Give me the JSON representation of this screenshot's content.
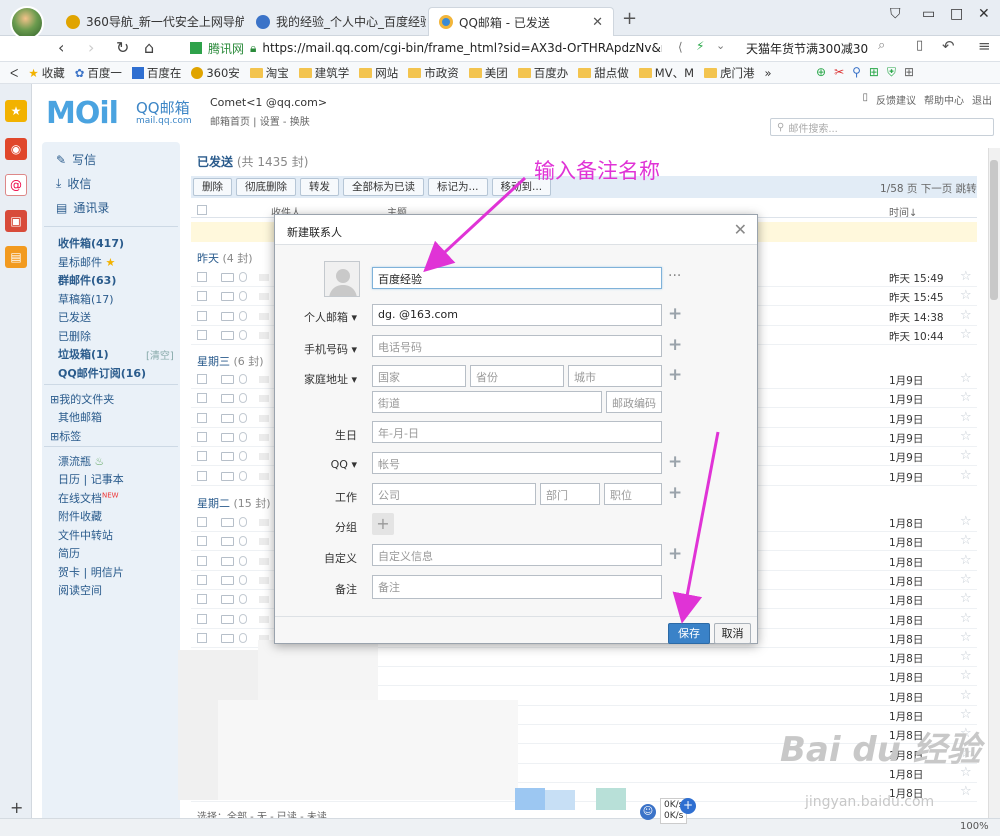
{
  "browser": {
    "tabs": [
      {
        "title": "360导航_新一代安全上网导航",
        "color": "#e0a400"
      },
      {
        "title": "我的经验_个人中心_百度经验",
        "color": "#3b73c8"
      },
      {
        "title": "QQ邮箱 - 已发送",
        "color": "#3a8bd6"
      }
    ],
    "new_tab": "+",
    "url_site": "腾讯网",
    "url": "https://mail.qq.com/cgi-bin/frame_html?sid=AX3d-OrTHRApdzNv&r=98c2",
    "search_hint": "天猫年货节满300减30"
  },
  "bookmarks": [
    "收藏",
    "百度一",
    "百度在",
    "360安",
    "淘宝",
    "建筑学",
    "网站",
    "市政资",
    "美团",
    "百度办",
    "甜点做",
    "MV、M",
    "虎门港"
  ],
  "mail": {
    "logo_main": "MOil",
    "logo_cn": "QQ邮箱",
    "logo_domain": "mail.qq.com",
    "account": "Comet<1        @qq.com>",
    "account_sub": "邮箱首页 | 设置 - 换肤",
    "top_links": [
      "反馈建议",
      "帮助中心",
      "退出"
    ],
    "search_placeholder": "邮件搜索...",
    "actions": {
      "write": "写信",
      "receive": "收信",
      "contacts": "通讯录"
    },
    "folders": [
      {
        "label": "收件箱(417)",
        "bold": true
      },
      {
        "label": "星标邮件",
        "bold": false
      },
      {
        "label": "群邮件(63)",
        "bold": true
      },
      {
        "label": "草稿箱(17)",
        "bold": false
      },
      {
        "label": "已发送",
        "bold": false
      },
      {
        "label": "已删除",
        "bold": false
      },
      {
        "label": "垃圾箱(1)",
        "bold": true
      },
      {
        "label": "QQ邮件订阅(16)",
        "bold": true
      }
    ],
    "clear_label": "[清空]",
    "folders2": [
      "我的文件夹",
      "其他邮箱",
      "标签"
    ],
    "tools": [
      "漂流瓶",
      "日历 | 记事本",
      "在线文档",
      "附件收藏",
      "文件中转站",
      "简历",
      "贺卡 | 明信片",
      "阅读空间"
    ],
    "list_title": "已发送",
    "list_count": "(共 1435 封)",
    "toolbar": [
      "删除",
      "彻底删除",
      "转发",
      "全部标为已读",
      "标记为...",
      "移动到..."
    ],
    "pager": "1/58 页  下一页  跳转",
    "columns": {
      "from": "收件人",
      "subject": "主题",
      "time": "时间↓"
    },
    "groups": [
      {
        "label": "昨天",
        "count": "(4 封)"
      },
      {
        "label": "星期三",
        "count": "(6 封)"
      },
      {
        "label": "星期二",
        "count": "(15 封)"
      }
    ],
    "times_yesterday": [
      "昨天 15:49",
      "昨天 15:45",
      "昨天 14:38",
      "昨天 10:44"
    ],
    "times_wed": [
      "1月9日",
      "1月9日",
      "1月9日",
      "1月9日",
      "1月9日",
      "1月9日"
    ],
    "times_tue": [
      "1月8日",
      "1月8日",
      "1月8日",
      "1月8日",
      "1月8日",
      "1月8日",
      "1月8日",
      "1月8日",
      "1月8日",
      "1月8日",
      "1月8日",
      "1月8日",
      "1月8日",
      "1月8日",
      "1月8日"
    ],
    "bottom_select": "选择：全部 - 无 - 已读 - 未读"
  },
  "dialog": {
    "title": "新建联系人",
    "name_value": "百度经验",
    "email_label": "个人邮箱",
    "email_value": "dg.        @163.com",
    "phone_label": "手机号码",
    "phone_placeholder": "电话号码",
    "address_label": "家庭地址",
    "country_placeholder": "国家",
    "province_placeholder": "省份",
    "city_placeholder": "城市",
    "street_placeholder": "街道",
    "zip_placeholder": "邮政编码",
    "birthday_label": "生日",
    "birthday_placeholder": "年-月-日",
    "qq_label": "QQ",
    "qq_placeholder": "帐号",
    "work_label": "工作",
    "company_placeholder": "公司",
    "dept_placeholder": "部门",
    "position_placeholder": "职位",
    "group_label": "分组",
    "custom_label": "自定义",
    "custom_placeholder": "自定义信息",
    "note_label": "备注",
    "note_placeholder": "备注",
    "save": "保存",
    "cancel": "取消",
    "more": "···",
    "plus": "+"
  },
  "annotation": {
    "text": "输入备注名称",
    "color": "#e033d6"
  },
  "watermark": {
    "main": "Bai du 经验",
    "sub": "jingyan.baidu.com"
  },
  "status": {
    "speed1": "0K/s",
    "speed2": "0K/s",
    "zoom": "100%"
  }
}
